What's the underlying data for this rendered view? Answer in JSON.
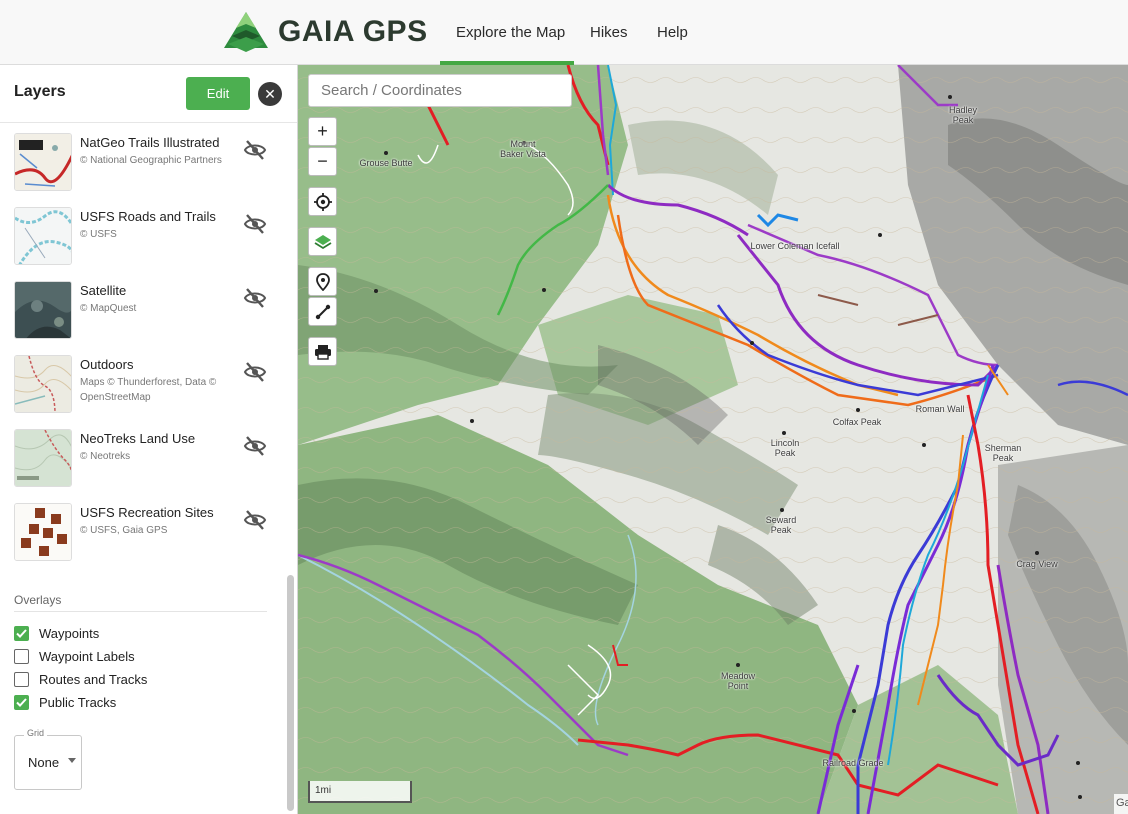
{
  "header": {
    "logo_text": "GAIA GPS",
    "nav": [
      "Explore the Map",
      "Hikes",
      "Help"
    ]
  },
  "sidebar": {
    "title": "Layers",
    "edit_label": "Edit",
    "close_icon": "close-icon",
    "layers": [
      {
        "name": "NatGeo Trails Illustrated",
        "credit": "© National Geographic Partners"
      },
      {
        "name": "USFS Roads and Trails",
        "credit": "© USFS"
      },
      {
        "name": "Satellite",
        "credit": "© MapQuest"
      },
      {
        "name": "Outdoors",
        "credit": "Maps © Thunderforest, Data © OpenStreetMap"
      },
      {
        "name": "NeoTreks Land Use",
        "credit": "© Neotreks"
      },
      {
        "name": "USFS Recreation Sites",
        "credit": "© USFS, Gaia GPS"
      }
    ],
    "overlays_title": "Overlays",
    "overlays": [
      {
        "label": "Waypoints",
        "checked": true
      },
      {
        "label": "Waypoint Labels",
        "checked": false
      },
      {
        "label": "Routes and Tracks",
        "checked": false
      },
      {
        "label": "Public Tracks",
        "checked": true
      }
    ],
    "grid": {
      "label": "Grid",
      "value": "None"
    }
  },
  "map": {
    "search_placeholder": "Search / Coordinates",
    "zoom_in": "+",
    "zoom_out": "−",
    "scale": "1mi",
    "attribution": "Ga",
    "labels": {
      "grouse_butte": "Grouse Butte",
      "mount_baker_vista": "Mount Baker Vista",
      "hadley_peak": "Hadley Peak",
      "coleman_icefall": "Lower Coleman Icefall",
      "colfax_peak": "Colfax Peak",
      "lincoln_peak": "Lincoln Peak",
      "roman_wall": "Roman Wall",
      "sherman_peak": "Sherman Peak",
      "seward_peak": "Seward Peak",
      "crag_view": "Crag View",
      "meadow_point": "Meadow Point",
      "railroad_grade": "Railroad Grade"
    }
  },
  "colors": {
    "accent": "#4caf50",
    "track_red": "#e31e24",
    "track_purple": "#8e2bc2",
    "track_blue": "#3b3bd6",
    "track_orange": "#f08a1c",
    "track_green": "#43b847"
  }
}
